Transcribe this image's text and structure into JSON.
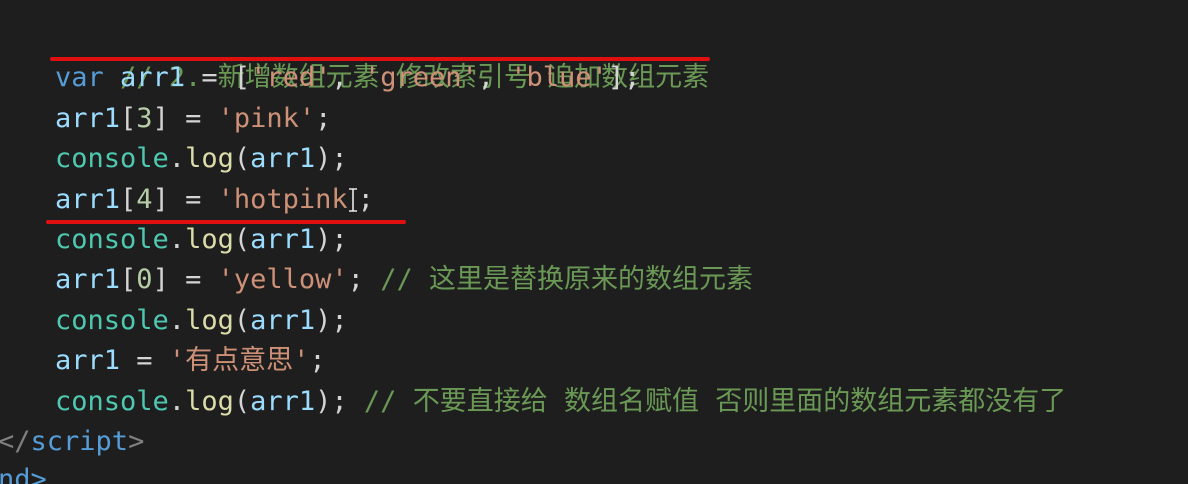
{
  "colors": {
    "background": "#1e1e1e",
    "comment": "#6a9955",
    "keyword": "#569cd6",
    "variable": "#9cdcfe",
    "string": "#ce9178",
    "number": "#b5cea8",
    "console": "#4ec9b0",
    "function": "#dcdcaa",
    "annotation_underline": "#e01010"
  },
  "code": {
    "line1": {
      "comment": "// 2. 新增数组元素 修改索引号 追加数组元素"
    },
    "line2": {
      "kw": "var",
      "var": "arr1",
      "op": "=",
      "open": "[",
      "s1": "'red'",
      "c1": ",",
      "s2": "'green'",
      "c2": ",",
      "s3": "'blue'",
      "close": "];"
    },
    "line3": {
      "var": "arr1",
      "idx_open": "[",
      "idx": "3",
      "idx_close": "]",
      "op": "=",
      "str": "'pink'",
      "end": ";"
    },
    "line4": {
      "obj": "console",
      "dot": ".",
      "fn": "log",
      "open": "(",
      "arg": "arr1",
      "close": ");"
    },
    "line5": {
      "var": "arr1",
      "idx_open": "[",
      "idx": "4",
      "idx_close": "]",
      "op": "=",
      "str": "'hotpink",
      "end": ";"
    },
    "line6": {
      "obj": "console",
      "dot": ".",
      "fn": "log",
      "open": "(",
      "arg": "arr1",
      "close": ");"
    },
    "line7": {
      "var": "arr1",
      "idx_open": "[",
      "idx": "0",
      "idx_close": "]",
      "op": "=",
      "str": "'yellow'",
      "end": ";",
      "comment": "// 这里是替换原来的数组元素"
    },
    "line8": {
      "obj": "console",
      "dot": ".",
      "fn": "log",
      "open": "(",
      "arg": "arr1",
      "close": ");"
    },
    "line9": {
      "var": "arr1",
      "op": "=",
      "str": "'有点意思'",
      "end": ";"
    },
    "line10": {
      "obj": "console",
      "dot": ".",
      "fn": "log",
      "open": "(",
      "arg": "arr1",
      "close": ");",
      "comment": "// 不要直接给 数组名赋值 否则里面的数组元素都没有了"
    },
    "line11": {
      "open": "</",
      "tag": "script",
      "close": ">"
    },
    "line12": {
      "text": "nd>"
    }
  }
}
